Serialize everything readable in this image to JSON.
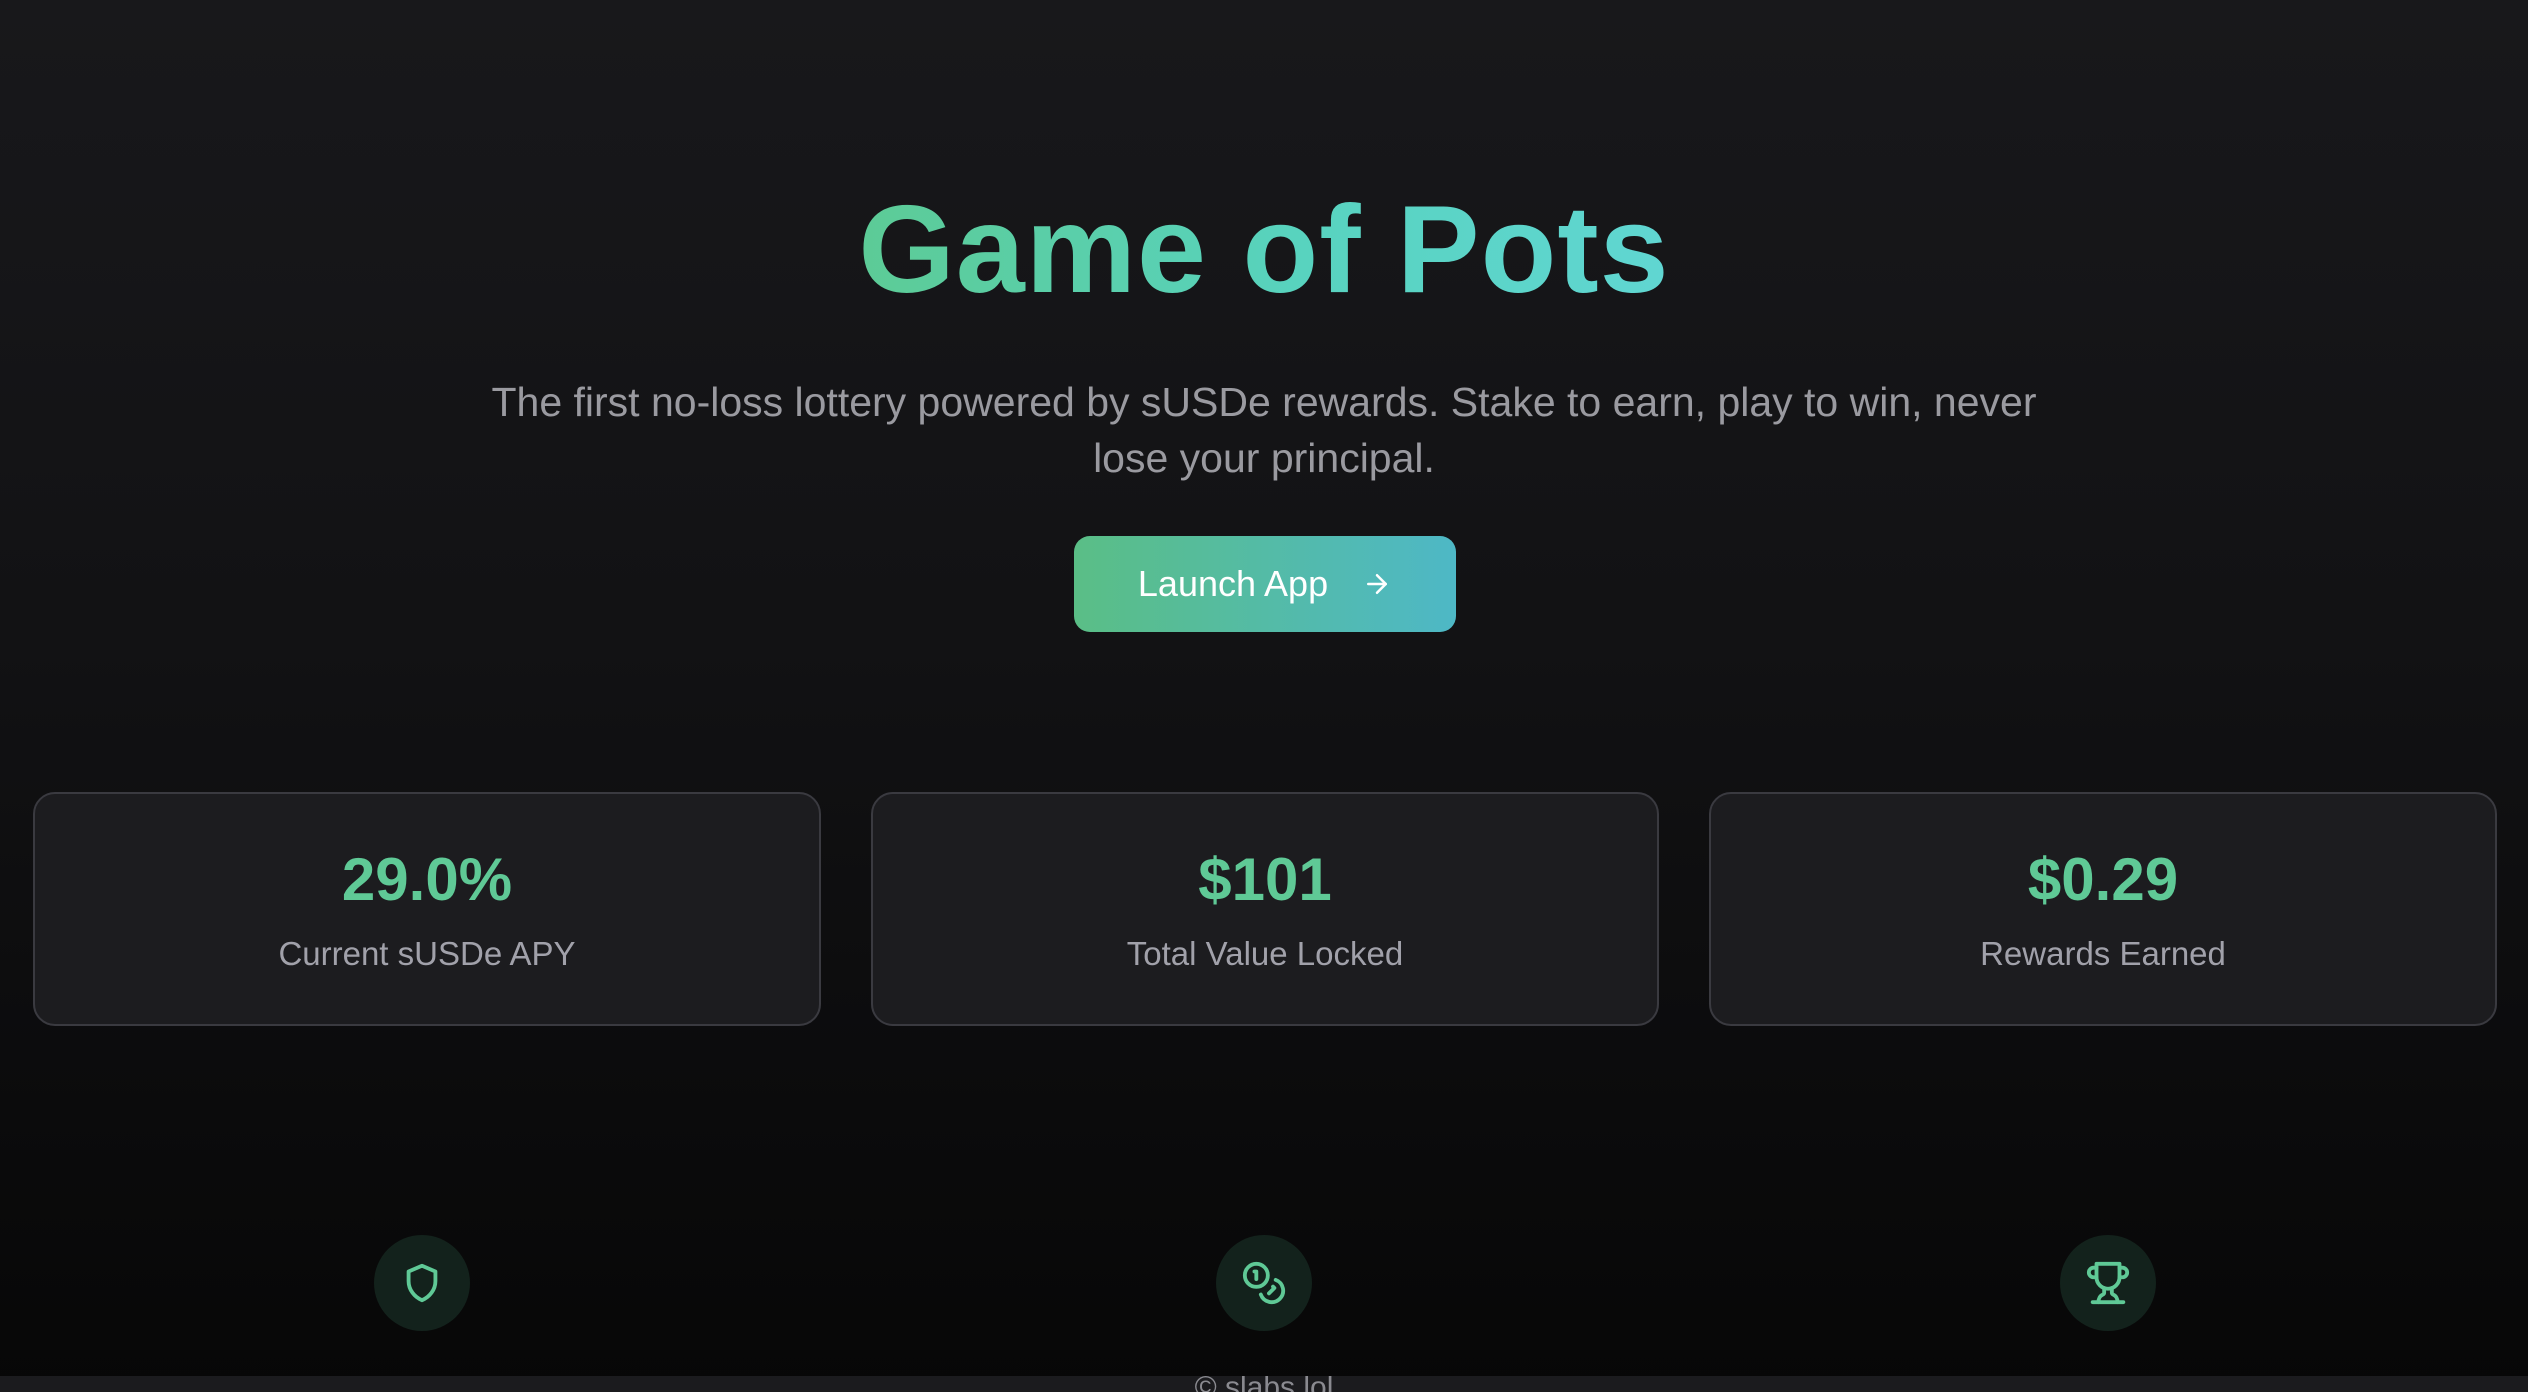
{
  "hero": {
    "title": "Game of Pots",
    "subtitle": "The first no-loss lottery powered by sUSDe rewards. Stake to earn, play to win, never lose your principal.",
    "cta_label": "Launch App",
    "cta_icon": "arrow-right-icon"
  },
  "stats": [
    {
      "value": "29.0%",
      "label": "Current sUSDe APY"
    },
    {
      "value": "$101",
      "label": "Total Value Locked"
    },
    {
      "value": "$0.29",
      "label": "Rewards Earned"
    }
  ],
  "features": [
    {
      "icon": "shield-icon"
    },
    {
      "icon": "coins-icon"
    },
    {
      "icon": "trophy-icon"
    }
  ],
  "footer": {
    "text": "© slabs.lol"
  },
  "colors": {
    "background": "#121214",
    "accent_green": "#5fc996",
    "accent_teal": "#4eb8c6",
    "card_bg": "#1c1c1f",
    "card_border": "#3a3a40",
    "muted_text": "#9a9aa0"
  }
}
